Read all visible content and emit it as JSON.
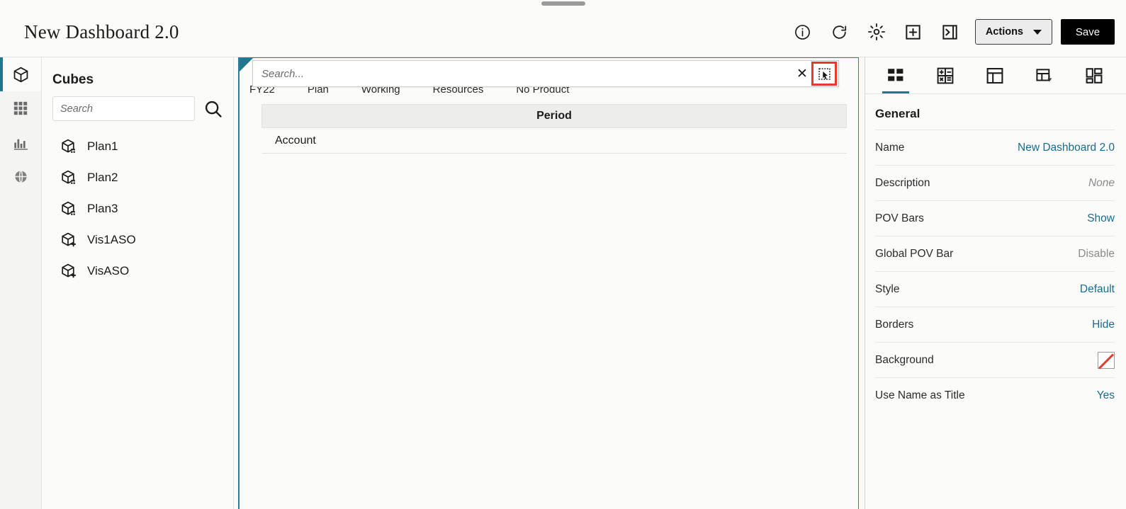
{
  "header": {
    "title": "New Dashboard 2.0",
    "icons": [
      {
        "name": "info-icon",
        "label": "Info"
      },
      {
        "name": "refresh-icon",
        "label": "Refresh"
      },
      {
        "name": "gear-icon",
        "label": "Settings"
      },
      {
        "name": "add-box-icon",
        "label": "Add"
      },
      {
        "name": "collapse-panel-icon",
        "label": "Collapse Panel"
      }
    ],
    "actions_label": "Actions",
    "save_label": "Save"
  },
  "rail": {
    "items": [
      {
        "name": "sidebar-item-cubes",
        "icon": "cube-icon",
        "active": true
      },
      {
        "name": "sidebar-item-grid",
        "icon": "grid-icon",
        "active": false
      },
      {
        "name": "sidebar-item-charts",
        "icon": "bar-chart-icon",
        "active": false
      },
      {
        "name": "sidebar-item-global",
        "icon": "globe-icon",
        "active": false
      }
    ]
  },
  "cubes": {
    "title": "Cubes",
    "search_placeholder": "Search",
    "search_value": "",
    "items": [
      {
        "label": "Plan1",
        "icon": "cube-bso-icon"
      },
      {
        "label": "Plan2",
        "icon": "cube-bso-icon"
      },
      {
        "label": "Plan3",
        "icon": "cube-bso-icon"
      },
      {
        "label": "Vis1ASO",
        "icon": "cube-aso-icon"
      },
      {
        "label": "VisASO",
        "icon": "cube-aso-icon"
      }
    ]
  },
  "canvas": {
    "search_overlay": {
      "placeholder": "Search...",
      "value": "",
      "clear_label": "✕",
      "select_tool_name": "selection-cursor-icon",
      "highlight_color": "#e8392e"
    },
    "pov_bar": [
      "FY22",
      "Plan",
      "Working",
      "Resources",
      "No Product"
    ],
    "grid": {
      "column_header": "Period",
      "row_header": "Account"
    }
  },
  "properties": {
    "tabs": [
      {
        "name": "tab-general",
        "icon": "layout-blocks-icon",
        "active": true
      },
      {
        "name": "tab-calculation",
        "icon": "calculator-icon",
        "active": false
      },
      {
        "name": "tab-layout",
        "icon": "layout-panes-icon",
        "active": false
      },
      {
        "name": "tab-actions",
        "icon": "table-lightning-icon",
        "active": false
      },
      {
        "name": "tab-more",
        "icon": "layout-split-icon",
        "active": false
      }
    ],
    "section_title": "General",
    "rows": [
      {
        "label": "Name",
        "value": "New Dashboard 2.0",
        "style": "link"
      },
      {
        "label": "Description",
        "value": "None",
        "style": "muted-italic"
      },
      {
        "label": "POV Bars",
        "value": "Show",
        "style": "link"
      },
      {
        "label": "Global POV Bar",
        "value": "Disable",
        "style": "muted"
      },
      {
        "label": "Style",
        "value": "Default",
        "style": "link"
      },
      {
        "label": "Borders",
        "value": "Hide",
        "style": "link"
      },
      {
        "label": "Background",
        "value": "",
        "style": "swatch"
      },
      {
        "label": "Use Name as Title",
        "value": "Yes",
        "style": "link"
      }
    ]
  },
  "colors": {
    "accent_teal": "#20788f",
    "link": "#1b6b8c",
    "highlight_red": "#e8392e",
    "page_bg": "#fafaf9"
  }
}
